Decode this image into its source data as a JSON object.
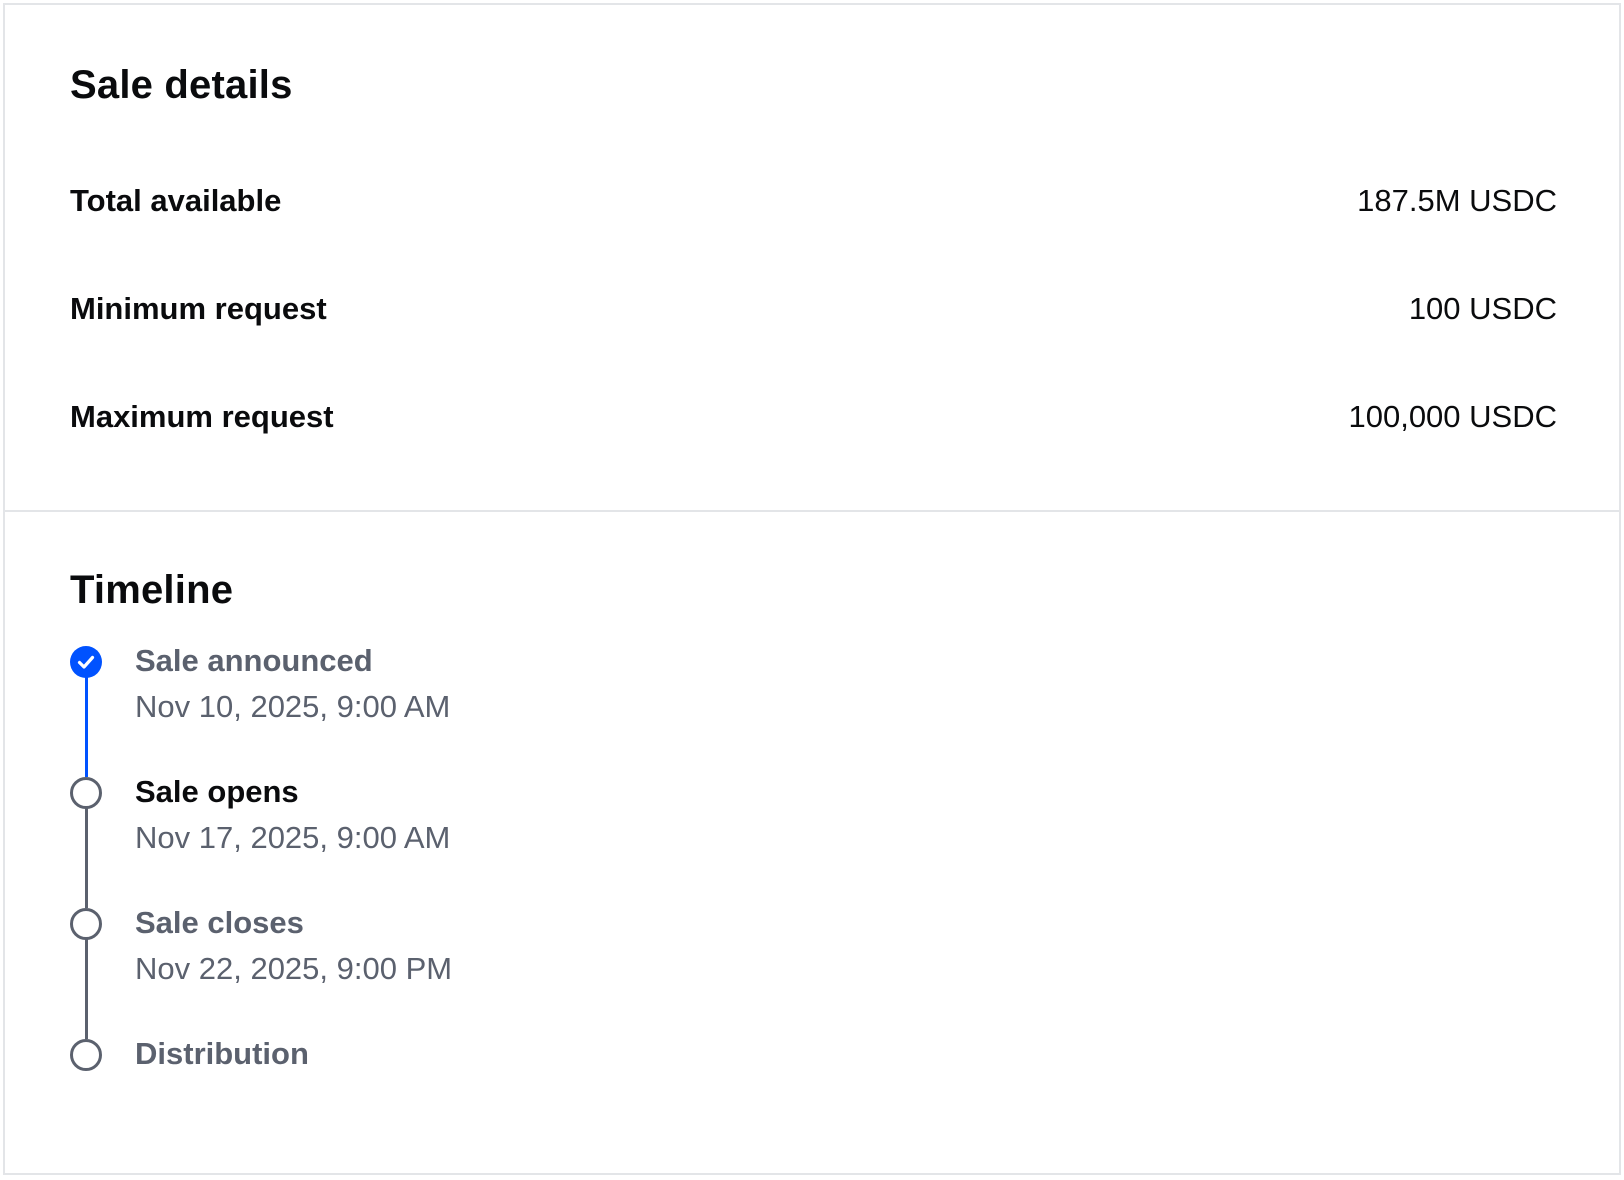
{
  "sale_details": {
    "title": "Sale details",
    "rows": [
      {
        "label": "Total available",
        "value": "187.5M USDC"
      },
      {
        "label": "Minimum request",
        "value": "100 USDC"
      },
      {
        "label": "Maximum request",
        "value": "100,000 USDC"
      }
    ]
  },
  "timeline": {
    "title": "Timeline",
    "steps": [
      {
        "label": "Sale announced",
        "date": "Nov 10, 2025, 9:00 AM",
        "status": "completed"
      },
      {
        "label": "Sale opens",
        "date": "Nov 17, 2025, 9:00 AM",
        "status": "upcoming-current"
      },
      {
        "label": "Sale closes",
        "date": "Nov 22, 2025, 9:00 PM",
        "status": "upcoming"
      },
      {
        "label": "Distribution",
        "status": "upcoming"
      }
    ]
  },
  "colors": {
    "accent": "#0052ff",
    "text_primary": "#0a0b0d",
    "text_muted": "#5b616e",
    "divider": "#e3e5e8"
  },
  "icons": {
    "completed_step": "check-circle-icon",
    "pending_step": "empty-circle-icon"
  }
}
